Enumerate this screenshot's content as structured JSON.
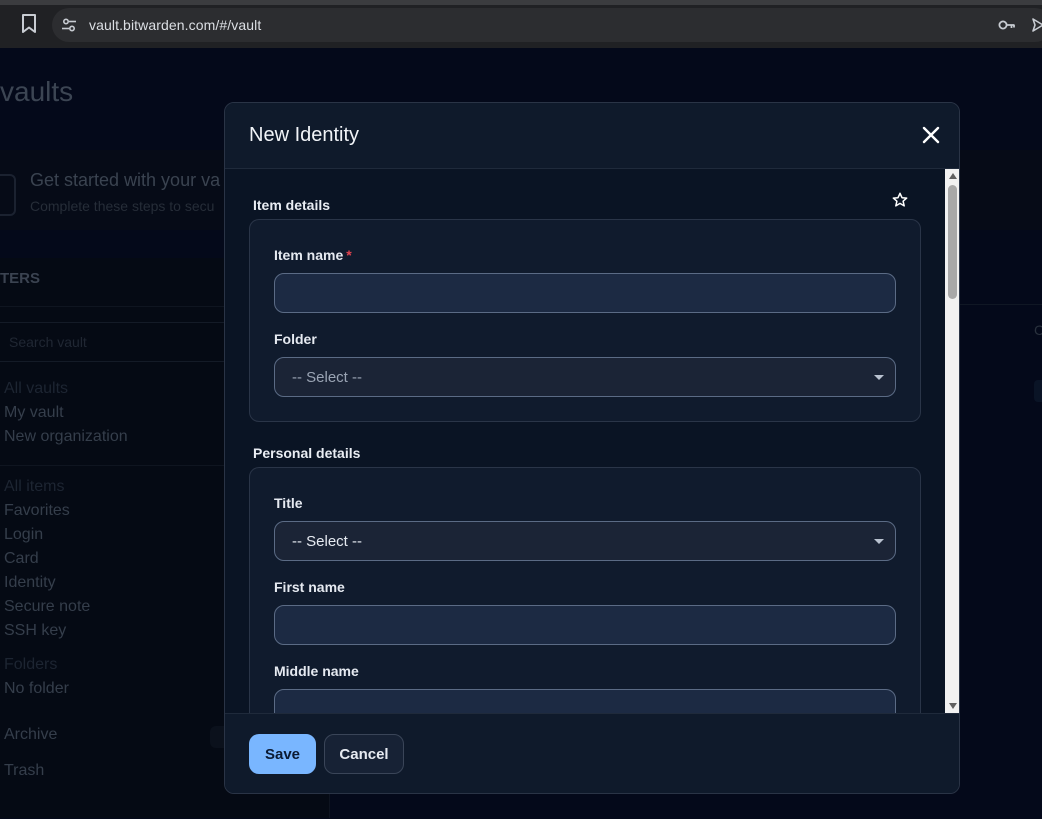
{
  "browser": {
    "url": "vault.bitwarden.com/#/vault",
    "icons": [
      "bookmark-icon",
      "tune-icon",
      "key-icon",
      "send-icon"
    ]
  },
  "background": {
    "page_title": "vaults",
    "banner_title": "Get started with your va",
    "banner_subtitle": "Complete these steps to secu",
    "filters_heading": "TERS",
    "search_placeholder": "Search vault",
    "vault_items": [
      "All vaults",
      "My vault",
      "New organization"
    ],
    "type_items": [
      "All items",
      "Favorites",
      "Login",
      "Card",
      "Identity",
      "Secure note",
      "SSH key"
    ],
    "folder_items": [
      "Folders",
      "No folder"
    ],
    "archive": "Archive",
    "trash": "Trash",
    "right_header_fragment": "C"
  },
  "modal": {
    "title": "New Identity",
    "close_icon": "close-icon",
    "favorite_icon": "star-outline-icon",
    "item_details": {
      "section_label": "Item details",
      "item_name_label": "Item name",
      "required_mark": "*",
      "item_name_value": "",
      "folder_label": "Folder",
      "folder_selected": "-- Select --"
    },
    "personal_details": {
      "section_label": "Personal details",
      "title_label": "Title",
      "title_selected": "-- Select --",
      "first_name_label": "First name",
      "first_name_value": "",
      "middle_name_label": "Middle name",
      "middle_name_value": ""
    },
    "footer": {
      "save_label": "Save",
      "cancel_label": "Cancel"
    }
  },
  "colors": {
    "accent": "#79b6ff",
    "modal_bg": "#0a1424",
    "required": "#e2434f"
  }
}
